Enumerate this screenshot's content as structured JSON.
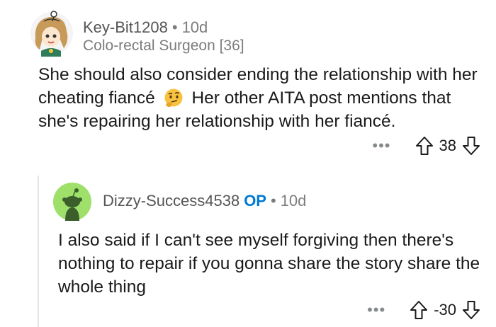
{
  "comment": {
    "username": "Key-Bit1208",
    "separator": "•",
    "age": "10d",
    "flair": "Colo-rectal Surgeon [36]",
    "text_before_emoji": "She should also consider ending the relationship with her cheating fiancé",
    "emoji": "thinking-face",
    "text_after_emoji": "Her other AITA post mentions that she's repairing her relationship with her fiancé.",
    "more_label": "•••",
    "score": "38"
  },
  "reply": {
    "username": "Dizzy-Success4538",
    "op_badge": "OP",
    "separator": "•",
    "age": "10d",
    "text": "I also said if I can't see myself forgiving then there's nothing to repair if you gonna share the story share the whole thing",
    "more_label": "•••",
    "score": "-30"
  },
  "colors": {
    "op_badge": "#0079d3",
    "reply_avatar_bg": "#9ee06a",
    "meta_text": "#7c7c7c"
  }
}
